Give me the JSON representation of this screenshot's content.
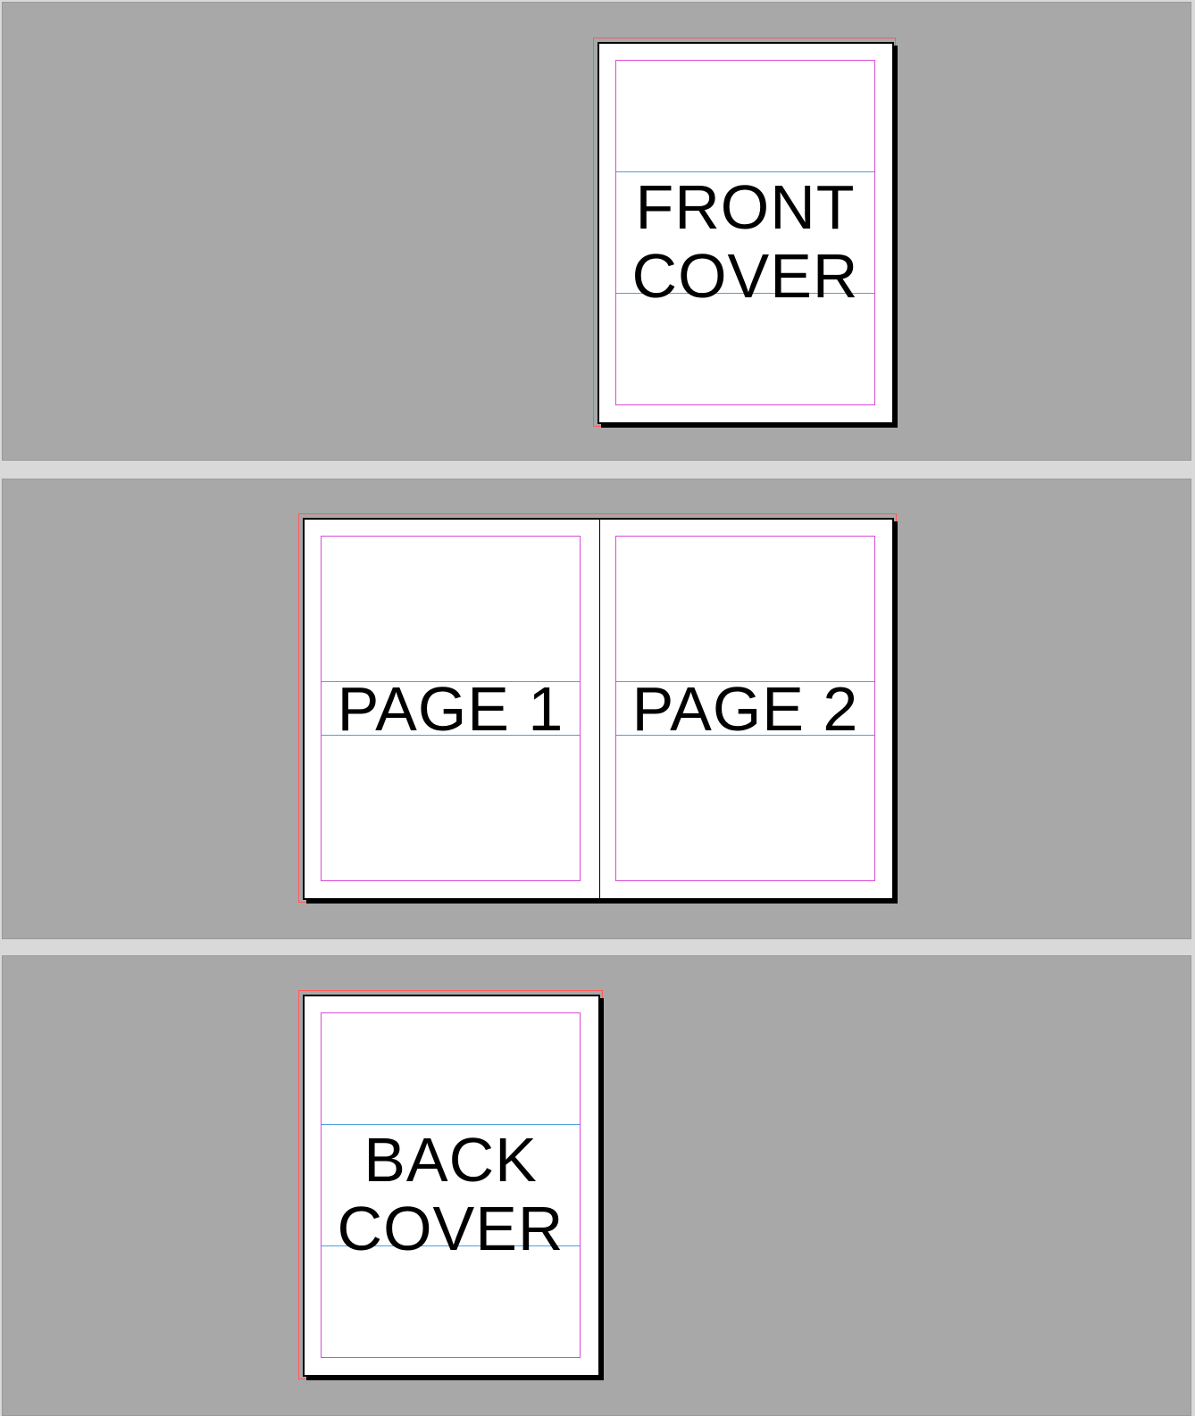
{
  "document": {
    "spreads": [
      {
        "name": "front-cover-spread",
        "pages": [
          {
            "label_lines": [
              "FRONT",
              "COVER"
            ]
          }
        ]
      },
      {
        "name": "interior-spread",
        "pages": [
          {
            "label_lines": [
              "PAGE 1"
            ]
          },
          {
            "label_lines": [
              "PAGE 2"
            ]
          }
        ]
      },
      {
        "name": "back-cover-spread",
        "pages": [
          {
            "label_lines": [
              "BACK",
              "COVER"
            ]
          }
        ]
      }
    ]
  },
  "colors": {
    "pasteboard": "#a8a8a8",
    "page": "#ffffff",
    "bleed_guide": "#ff5a5a",
    "margin_guide": "#d84bd8",
    "text_frame": "#4aa3df"
  }
}
